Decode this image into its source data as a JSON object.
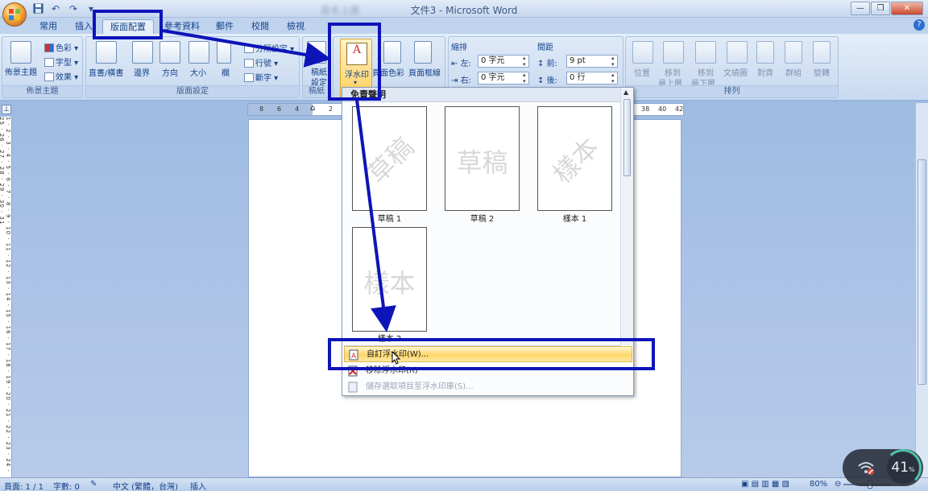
{
  "window": {
    "title": "文件3 - Microsoft Word",
    "blurred_title": "基本上課"
  },
  "quick_access": [
    "save-icon",
    "undo-icon",
    "redo-icon",
    "customize-icon"
  ],
  "tabs": [
    {
      "label": "常用"
    },
    {
      "label": "插入"
    },
    {
      "label": "版面配置",
      "active": true
    },
    {
      "label": "參考資料"
    },
    {
      "label": "郵件"
    },
    {
      "label": "校閱"
    },
    {
      "label": "檢視"
    }
  ],
  "ribbon": {
    "theme_group": {
      "label": "佈景主題",
      "themes_button": "佈景主題",
      "colors": "色彩",
      "fonts": "字型",
      "effects": "效果"
    },
    "page_setup_group": {
      "label": "版面設定",
      "text_direction": "直書/橫書",
      "margins": "邊界",
      "orientation": "方向",
      "size": "大小",
      "columns": "欄",
      "breaks": "分隔設定",
      "line_numbers": "行號",
      "hyphenation": "斷字"
    },
    "manuscript_group": {
      "label": "稿紙",
      "button_line1": "稿紙",
      "button_line2": "設定"
    },
    "page_background_group": {
      "watermark": "浮水印",
      "page_color": "頁面色彩",
      "page_borders": "頁面框線"
    },
    "paragraph_group": {
      "indent_label": "縮排",
      "left_label": "左:",
      "left_value": "0 字元",
      "right_label": "右:",
      "right_value": "0 字元",
      "spacing_label": "間距",
      "before_label": "前:",
      "before_value": "9 pt",
      "after_label": "後:",
      "after_value": "0 行"
    },
    "arrange_group": {
      "label": "排列",
      "position": "位置",
      "bring_forward_1": "移到",
      "bring_forward_2": "最上層",
      "send_backward_1": "移到",
      "send_backward_2": "最下層",
      "text_wrapping": "文繞圖",
      "align": "對齊",
      "group": "群組",
      "rotate": "旋轉"
    }
  },
  "ruler": {
    "left_ticks": [
      "8",
      "6",
      "4",
      "2",
      "2"
    ],
    "right_ticks": [
      "38",
      "40",
      "42"
    ]
  },
  "vruler_text": "1 · 2 · 3 · 4 · 5 · 6 · 7 · 8 · 9 · 10 · 11 · 12 · 13 · 14 · 15 · 16 · 17 · 18 · 19 · 20 · 21 · 22 · 23 · 24 · 25 · 26 · 27 · 28 · 29 · 30 · 31",
  "watermark_menu": {
    "header": "免責聲明",
    "items": [
      {
        "text": "草稿",
        "label": "草稿 1",
        "style": "diagonal"
      },
      {
        "text": "草稿",
        "label": "草稿 2",
        "style": "horizontal"
      },
      {
        "text": "樣本",
        "label": "樣本 1",
        "style": "diagonal"
      },
      {
        "text": "樣本",
        "label": "樣本 2",
        "style": "horizontal"
      }
    ],
    "commands": [
      {
        "label": "自訂浮水印(W)...",
        "state": "highlighted"
      },
      {
        "label": "移除浮水印(R)",
        "state": "normal"
      },
      {
        "label": "儲存選取項目至浮水印庫(S)...",
        "state": "disabled"
      }
    ]
  },
  "statusbar": {
    "page": "頁面: 1 / 1",
    "words": "字數: 0",
    "language": "中文 (繁體，台灣)",
    "mode": "插入",
    "zoom": "80%"
  },
  "overlay": {
    "value": "41",
    "unit": "%"
  },
  "colors": {
    "annotation": "#0d14b8",
    "ribbon_text": "#15428b",
    "highlight": "#ffd66a"
  }
}
